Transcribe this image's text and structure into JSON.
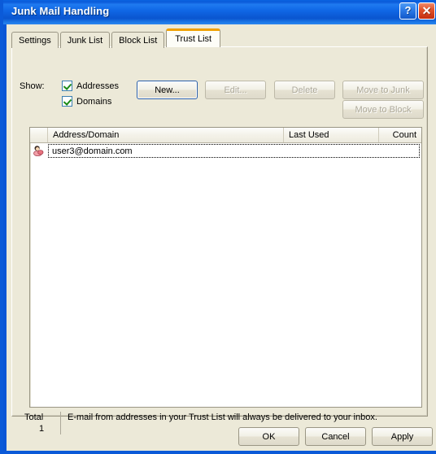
{
  "window": {
    "title": "Junk Mail Handling",
    "help_button": "?",
    "close_button": "✕"
  },
  "tabs": [
    {
      "label": "Settings",
      "active": false
    },
    {
      "label": "Junk List",
      "active": false
    },
    {
      "label": "Block List",
      "active": false
    },
    {
      "label": "Trust List",
      "active": true
    }
  ],
  "show": {
    "label": "Show:",
    "options": [
      {
        "label": "Addresses",
        "checked": true
      },
      {
        "label": "Domains",
        "checked": true
      }
    ]
  },
  "actions": {
    "new": "New...",
    "edit": "Edit...",
    "delete": "Delete",
    "move_to_junk": "Move to Junk",
    "move_to_block": "Move to Block"
  },
  "list": {
    "columns": [
      "Address/Domain",
      "Last Used",
      "Count"
    ],
    "rows": [
      {
        "icon": "contact-icon",
        "address": "user3@domain.com",
        "last_used": "",
        "count": ""
      }
    ]
  },
  "status": {
    "total_label": "Total",
    "total_value": "1",
    "description": "E-mail from addresses in your Trust List will always be delivered to your inbox."
  },
  "footer": {
    "ok": "OK",
    "cancel": "Cancel",
    "apply": "Apply"
  },
  "colors": {
    "titlebar_blue": "#0a56d6",
    "dialog_face": "#ece9d8",
    "active_tab_accent": "#f0a000",
    "close_red": "#c32e10",
    "check_green": "#1a8a16"
  }
}
